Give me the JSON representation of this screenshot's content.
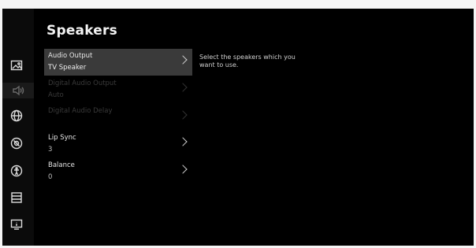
{
  "title": "Speakers",
  "sidebar": {
    "icons": [
      {
        "name": "picture-icon"
      },
      {
        "name": "sound-icon"
      },
      {
        "name": "network-icon"
      },
      {
        "name": "channel-icon"
      },
      {
        "name": "accessibility-icon"
      },
      {
        "name": "system-icon"
      },
      {
        "name": "support-icon"
      }
    ]
  },
  "menu": {
    "items": [
      {
        "label": "Audio Output",
        "value": "TV Speaker",
        "state": "selected"
      },
      {
        "label": "Digital Audio Output",
        "value": "Auto",
        "state": "disabled"
      },
      {
        "label": "Digital Audio Delay",
        "value": "",
        "state": "disabled"
      },
      {
        "label": "Lip Sync",
        "value": "3",
        "state": "normal"
      },
      {
        "label": "Balance",
        "value": "0",
        "state": "normal"
      }
    ]
  },
  "help_text": "Select the speakers which you want to use."
}
